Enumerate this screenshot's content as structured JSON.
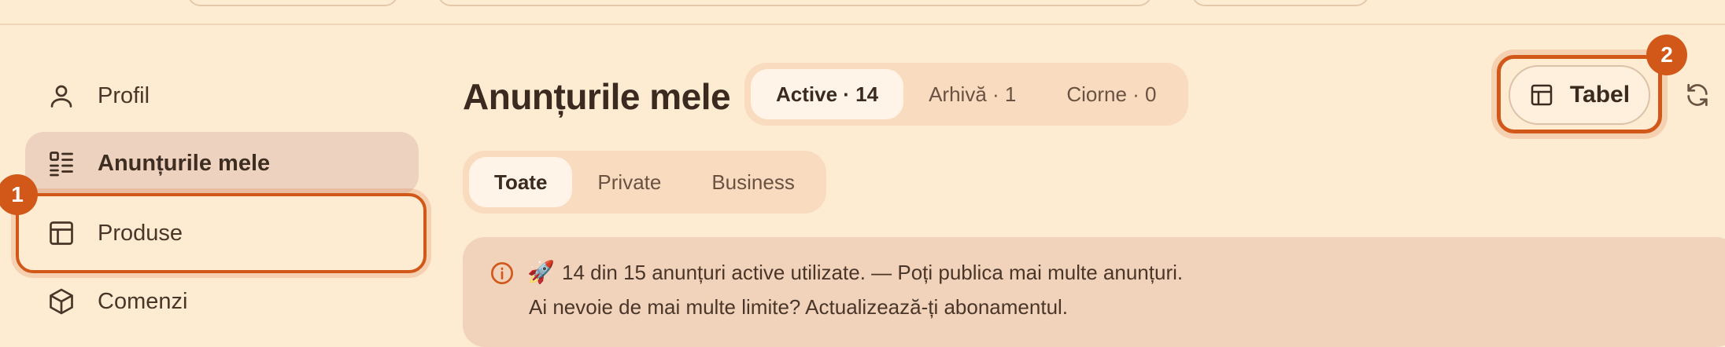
{
  "sidebar": {
    "items": [
      {
        "label": "Profil",
        "icon": "user-icon"
      },
      {
        "label": "Anunțurile mele",
        "icon": "list-icon"
      },
      {
        "label": "Produse",
        "icon": "table-icon"
      },
      {
        "label": "Comenzi",
        "icon": "box-icon"
      }
    ]
  },
  "badges": {
    "one": "1",
    "two": "2"
  },
  "main": {
    "title": "Anunțurile mele",
    "status_tabs": [
      "Active · 14",
      "Arhivă · 1",
      "Ciorne · 0"
    ],
    "filter_tabs": [
      "Toate",
      "Private",
      "Business"
    ],
    "view_button": "Tabel",
    "banner": {
      "rocket": "🚀",
      "line1": "14 din 15 anunțuri active utilizate. — Poți publica mai multe anunțuri.",
      "line2": "Ai nevoie de mai multe limite? Actualizează-ți abonamentul."
    }
  },
  "colors": {
    "accent": "#d2581a",
    "background": "#fdebd2"
  }
}
